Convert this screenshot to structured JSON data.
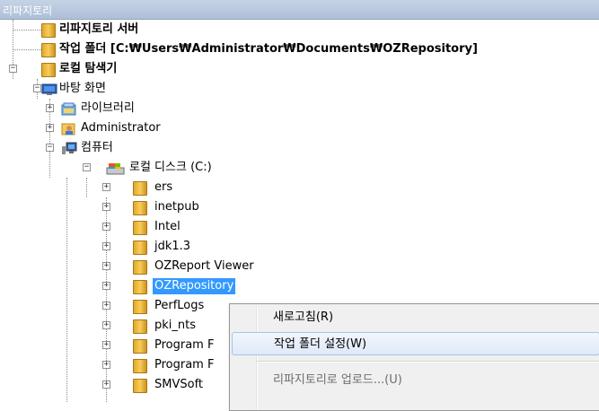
{
  "window": {
    "title": "리파지토리"
  },
  "tree": {
    "items": [
      {
        "label": "리파지토리 서버",
        "icon": "folder-icon"
      },
      {
        "label": "작업 폴더 [C:₩Users₩Administrator₩Documents₩OZRepository]",
        "icon": "folder-icon"
      },
      {
        "label": "로컬 탐색기",
        "icon": "folder-icon"
      },
      {
        "label": "바탕 화면",
        "icon": "desktop-icon"
      },
      {
        "label": "라이브러리",
        "icon": "library-icon"
      },
      {
        "label": "Administrator",
        "icon": "user-icon"
      },
      {
        "label": "컴퓨터",
        "icon": "computer-icon"
      },
      {
        "label": "로컬 디스크 (C:)",
        "icon": "drive-icon"
      },
      {
        "label": "ers",
        "icon": "folder-icon"
      },
      {
        "label": "inetpub",
        "icon": "folder-icon"
      },
      {
        "label": "Intel",
        "icon": "folder-icon"
      },
      {
        "label": "jdk1.3",
        "icon": "folder-icon"
      },
      {
        "label": "OZReport Viewer",
        "icon": "folder-icon"
      },
      {
        "label": "OZRepository",
        "icon": "folder-icon"
      },
      {
        "label": "PerfLogs",
        "icon": "folder-icon"
      },
      {
        "label": "pki_nts",
        "icon": "folder-icon"
      },
      {
        "label": "Program F",
        "icon": "folder-icon"
      },
      {
        "label": "Program F",
        "icon": "folder-icon"
      },
      {
        "label": "SMVSoft",
        "icon": "folder-icon"
      }
    ],
    "expander_plus": "+",
    "expander_minus": "−"
  },
  "context_menu": {
    "items": [
      {
        "label": "새로고침(R)"
      },
      {
        "label": "작업 폴더 설정(W)"
      },
      {
        "label": "리파지토리로 업로드...(U)"
      }
    ]
  },
  "colors": {
    "selection": "#3399ff",
    "titlebar": "#aebfd8",
    "folder": "#f6cf58"
  }
}
